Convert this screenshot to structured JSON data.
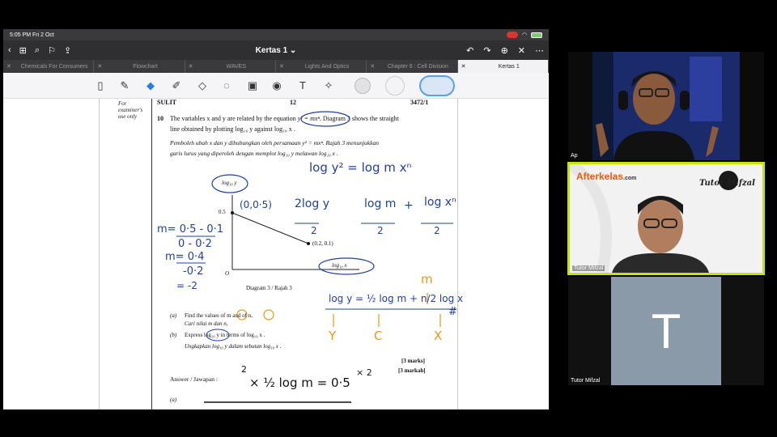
{
  "status_bar": {
    "time": "5:05 PM",
    "date": "Fri 2 Oct"
  },
  "nav": {
    "title": "Kertas 1",
    "title_chevron": "⌄"
  },
  "tabs": [
    {
      "label": "Chemicals For Consumers",
      "active": false
    },
    {
      "label": "Flowchart",
      "active": false
    },
    {
      "label": "WAVES",
      "active": false
    },
    {
      "label": "Lights And Optics",
      "active": false
    },
    {
      "label": "Chapter 6 : Cell Division",
      "active": false
    },
    {
      "label": "Kertas 1",
      "active": true
    }
  ],
  "toolbar": {
    "tools": [
      "sidebar-toggle-icon",
      "pen-icon",
      "eraser-icon",
      "highlighter-icon",
      "shapes-icon",
      "lasso-icon",
      "image-icon",
      "camera-icon",
      "text-icon",
      "laser-pointer-icon"
    ],
    "colors": [
      "#e2e2e4",
      "#f4f4f6",
      "#d9e6f5"
    ]
  },
  "document": {
    "margin_note": [
      "For",
      "examiner's",
      "use only"
    ],
    "header_left": "SULIT",
    "header_page": "12",
    "header_right": "3472/1",
    "q_number": "10",
    "q_en_line1a": "The variables x and y are related by the equation",
    "q_eq": "y² = mxⁿ",
    "q_en_line1b": ". Diagram 3 shows the straight",
    "q_en_line2": "line obtained by plotting log₁₀ y against log₁₀ x .",
    "q_ms_line1": "Pemboleh ubah x dan y dihubungkan oleh persamaan y² = mxⁿ. Rajah 3 menunjukkan",
    "q_ms_line2": "garis lurus yang diperoleh dengan memplot log₁₀ y melawan log₁₀ x .",
    "diagram": {
      "y_axis_label": "log₁₀ y",
      "x_axis_label": "log₁₀ x",
      "y_tick": "0.5",
      "origin": "O",
      "point_label": "(0.2, 0.1)",
      "caption": "Diagram 3 / Rajah 3"
    },
    "part_a_label": "(a)",
    "part_a_en": "Find the values of m and of n,",
    "part_a_ms": "Cari nilai m dan n,",
    "part_b_label": "(b)",
    "part_b_en": "Express log₁₀ y in terms of log₁₀ x .",
    "part_b_ms": "Ungkapkan log₁₀ y dalam sebutan log₁₀ x .",
    "marks_en": "[3 marks]",
    "marks_ms": "[3 markah]",
    "answer_label": "Answer / Jawapan :",
    "answer_a": "(a)"
  },
  "annotations": {
    "eq1": "log y² = log m xⁿ",
    "point_01_05": "(0,0·5)",
    "eq2_left": "2log y",
    "eq2_den": "2",
    "eq2_mid": "log m",
    "eq2_plus": "+",
    "eq2_right": "log xⁿ",
    "m_calc1_num": "m= 0·5 - 0·1",
    "m_calc1_den": "0 - 0·2",
    "m_calc2_num": "m= 0·4",
    "m_calc2_den": "-0·2",
    "m_calc3": "= -2",
    "eq3": "log y = ½ log m + n/2 log x",
    "eq3_hash": "#",
    "map_y": "Y",
    "map_c": "C",
    "map_x": "X",
    "map_m": "m",
    "ans_line_pre": "2",
    "ans_line": "× ½ log m = 0·5",
    "ans_line_post": "× 2"
  },
  "participants": [
    {
      "name": "Ap",
      "type": "video"
    },
    {
      "name": "Tutor Mifzal",
      "type": "video",
      "brand_left": "Afterkelas",
      "brand_left_sub": ".com",
      "brand_right": "Tutor Mifzal"
    },
    {
      "name": "Tutor Mifzal",
      "type": "avatar",
      "initial": "T"
    }
  ],
  "colors": {
    "ink_blue": "#1e3fa8",
    "ink_orange": "#f0960f",
    "active_speaker": "#c9e400",
    "tile_gray": "#8a9aa8"
  }
}
